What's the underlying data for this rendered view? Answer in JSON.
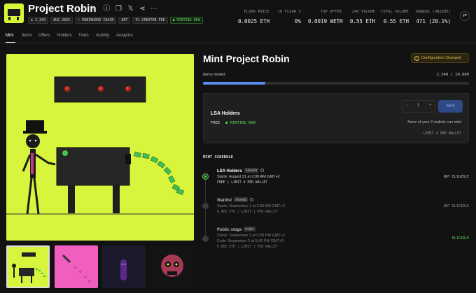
{
  "collection": {
    "title": "Project Robin",
    "tags": [
      {
        "text": "2,349",
        "icon": "chat-icon"
      },
      {
        "text": "AUG 2025"
      },
      {
        "text": "ROBINHOOD CHAIN",
        "icon": "bolt-icon"
      },
      {
        "text": "ART"
      },
      {
        "text": "5% CREATOR FEE"
      },
      {
        "text": "MINTING NOW",
        "icon": "live-icon"
      }
    ]
  },
  "stats": [
    {
      "label": "FLOOR PRICE",
      "value": "0.0025 ETH"
    },
    {
      "label": "1D FLOOR %",
      "value": "0%"
    },
    {
      "label": "TOP OFFER",
      "value": "0.0019 WETH"
    },
    {
      "label": "24H VOLUME",
      "value": "0.55 ETH"
    },
    {
      "label": "TOTAL VOLUME",
      "value": "0.55 ETH"
    },
    {
      "label": "OWNERS (UNIQUE)",
      "value": "471 (20.1%)"
    }
  ],
  "tabs": [
    "Mint",
    "Items",
    "Offers",
    "Holders",
    "Traits",
    "Activity",
    "Analytics"
  ],
  "mint": {
    "title": "Mint Project Robin",
    "config_badge": "Configuration Changed",
    "items_minted_label": "Items minted",
    "items_minted_value": "2,349 / 10,000",
    "progress_fraction": 0.2349
  },
  "stage_card": {
    "name": "LSA Holders",
    "price": "FREE",
    "status": "MINTING NOW",
    "quantity": "1",
    "minus": "−",
    "plus": "+",
    "mint_button": "Mint",
    "note": "None of your 2 wallets can mint",
    "limit": "LIMIT 4 PER WALLET"
  },
  "schedule": {
    "heading": "MINT SCHEDULE",
    "stages": [
      {
        "name": "LSA Holders",
        "badge": "Allowlist",
        "line1": "Starts: August 31 at 2:00 AM GMT+2",
        "line2": "",
        "meta": "FREE | LIMIT 4 PER WALLET",
        "eligibility": "NOT ELIGIBLE"
      },
      {
        "name": "Waitlist",
        "badge": "Allowlist",
        "line1": "Starts: September 1 at 2:00 AM GMT+2",
        "line2": "",
        "meta": "0.001 ETH | LIMIT 1 PER WALLET",
        "eligibility": "NOT ELIGIBLE"
      },
      {
        "name": "Public stage",
        "badge": "Public",
        "line1": "Starts: September 1 at 5:00 PM GMT+2",
        "line2": "Ends: September 2 at 5:00 PM GMT+2",
        "meta": "0.002 ETH | LIMIT 3 PER WALLET",
        "eligibility": "ELIGIBLE"
      }
    ]
  },
  "colors": {
    "accent_lime": "#d8f43c",
    "minting_green": "#62d15e",
    "progress_blue": "#5a8ff0",
    "warning_amber": "#e8c14a"
  }
}
